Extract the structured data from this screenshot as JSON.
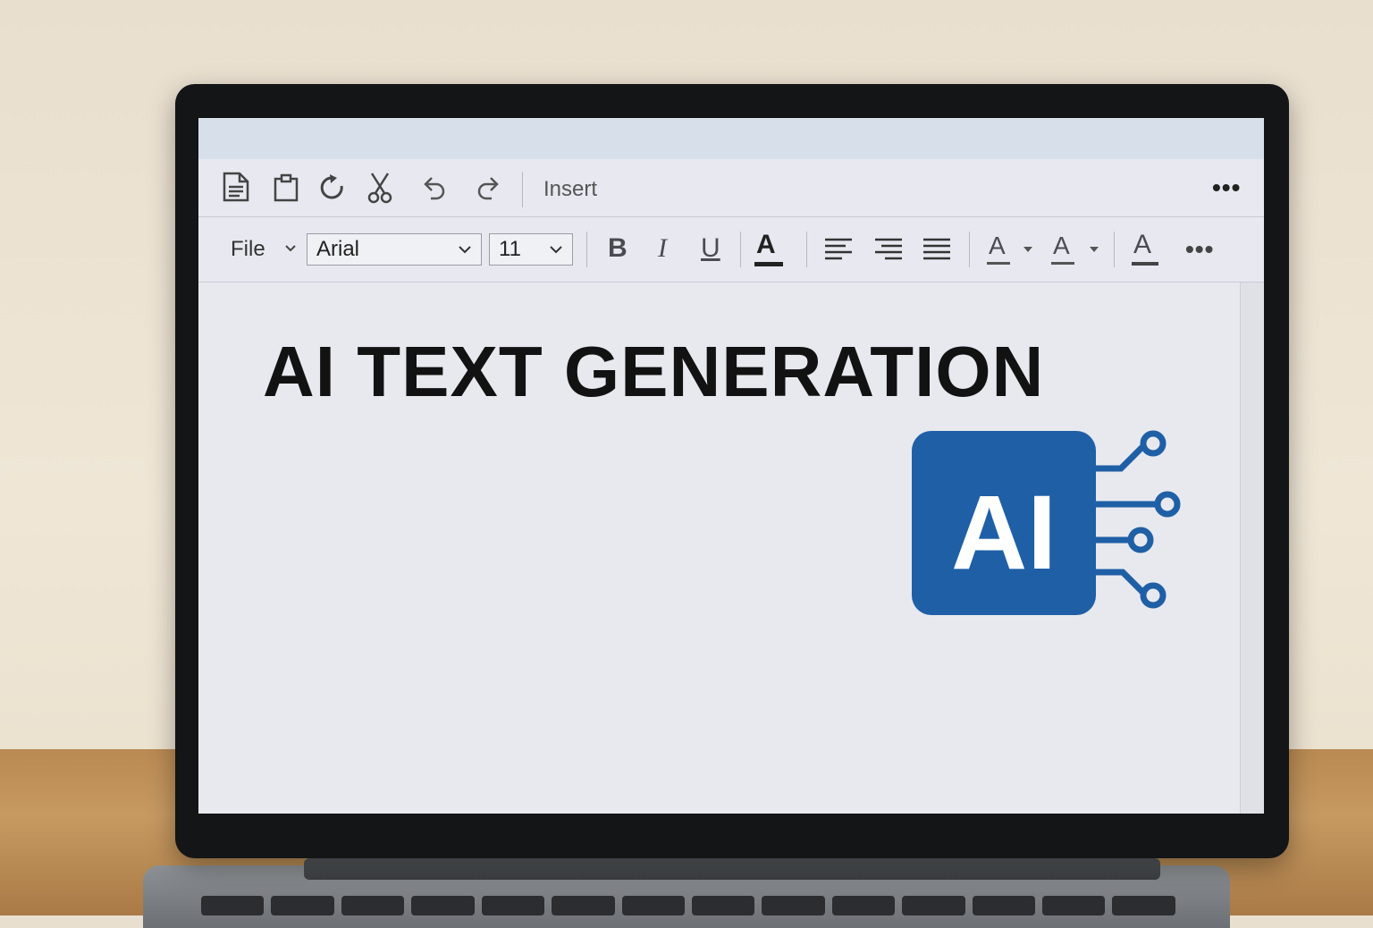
{
  "toolbar_top": {
    "icons": [
      "document-icon",
      "clipboard-icon",
      "redo-rotate-icon",
      "cut-icon",
      "undo-icon",
      "redo-icon"
    ],
    "insert_label": "Insert",
    "more_label": "•••"
  },
  "toolbar_format": {
    "file_label": "File",
    "font_value": "Arial",
    "size_value": "11",
    "bold_label": "B",
    "italic_label": "I",
    "underline_label": "U",
    "font_color_label": "A",
    "highlight_label": "A",
    "text_color_label": "A",
    "char_color_label": "A",
    "more_label": "•••"
  },
  "document": {
    "heading": "AI TEXT GENERATION",
    "logo_text": "AI"
  },
  "colors": {
    "accent": "#1f5fa6",
    "heading": "#121212"
  }
}
